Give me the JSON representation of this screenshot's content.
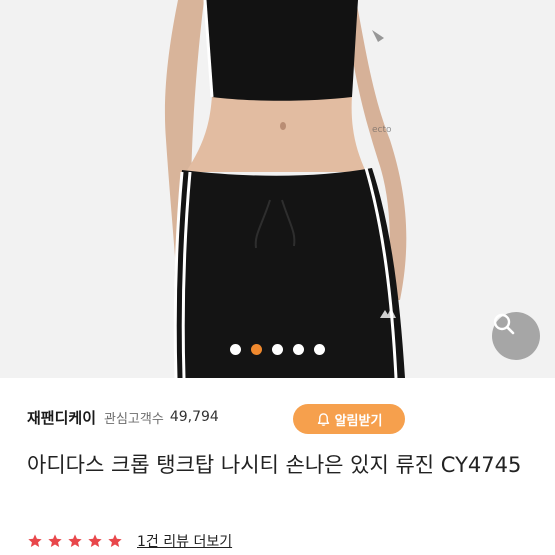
{
  "gallery": {
    "dots": [
      {
        "active": false
      },
      {
        "active": true
      },
      {
        "active": false
      },
      {
        "active": false
      },
      {
        "active": false
      }
    ],
    "zoom_icon": "magnifier-icon"
  },
  "shop": {
    "name": "재팬디케이",
    "favorite_label": "관심고객수",
    "favorite_count": "49,794",
    "alarm_button": "알림받기",
    "alarm_icon": "bell-icon"
  },
  "product": {
    "title": "아디다스 크롭 탱크탑 나시티 손나은 있지 류진 CY4745"
  },
  "rating": {
    "stars": 5,
    "star_color": "#e8474b",
    "review_link": "1건 리뷰 더보기"
  },
  "colors": {
    "accent": "#f6a04d",
    "active_dot": "#f0892e"
  }
}
